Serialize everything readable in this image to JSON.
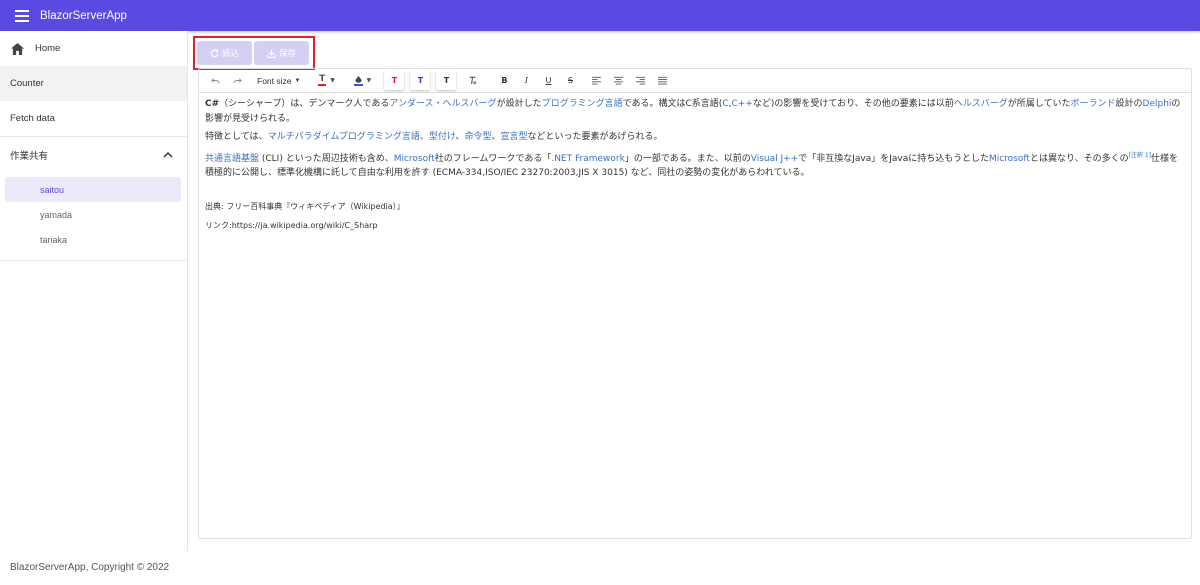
{
  "app": {
    "title": "BlazorServerApp"
  },
  "sidebar": {
    "home": "Home",
    "counter": "Counter",
    "fetch": "Fetch data",
    "group": {
      "label": "作業共有",
      "items": [
        "saitou",
        "yamada",
        "tanaka"
      ]
    }
  },
  "buttons": {
    "load": "読込",
    "save": "保存"
  },
  "toolbar": {
    "font_size": "Font size"
  },
  "colors": {
    "accent": "#594ae2",
    "highlight": "#e0202b",
    "link": "#3b6fc5"
  },
  "content": {
    "p1": {
      "bold": "C#",
      "t1": "（シーシャープ）は、デンマーク人である",
      "l1": "アンダース・ヘルスバーグ",
      "t2": "が設計した",
      "l2": "プログラミング言語",
      "t3": "である。構文はC系言語(",
      "l3": "C",
      "t4": ",",
      "l4": "C++",
      "t5": "など)の影響を受けており、その他の要素には以前",
      "l5": "ヘルスバーグ",
      "t6": "が所属していた",
      "l6": "ボーランド",
      "t7": "設計の",
      "l7": "Delphi",
      "t8": "の影響が見受けられる。"
    },
    "p2": {
      "t1": "特徴としては、",
      "l1": "マルチパラダイムプログラミング言語",
      "t2": "、",
      "l2": "型付け",
      "t3": "、",
      "l3": "命令型",
      "t4": "、",
      "l4": "宣言型",
      "t5": "などといった要素があげられる。"
    },
    "p3": {
      "l1": "共通言語基盤",
      "t1": " (CLI) といった周辺技術も含め、",
      "l2": "Microsoft",
      "t2": "社のフレームワークである「",
      "l3": ".NET Framework",
      "t3": "」の一部である。また、以前の",
      "l4": "Visual J++",
      "t4": "で「非互換なJava」をJavaに持ち込もうとした",
      "l5": "Microsoft",
      "t5": "とは異なり、その多くの",
      "sup": "[注釈 1]",
      "t6": "仕様を積極的に公開し、標準化機構に託して自由な利用を許す (ECMA-334,ISO/IEC 23270:2003,JIS X 3015) など、同社の姿勢の変化があらわれている。"
    },
    "source": "出典: フリー百科事典『ウィキペディア（Wikipedia）』",
    "link": "リンク:https://ja.wikipedia.org/wiki/C_Sharp"
  },
  "footer": "BlazorServerApp, Copyright © 2022"
}
